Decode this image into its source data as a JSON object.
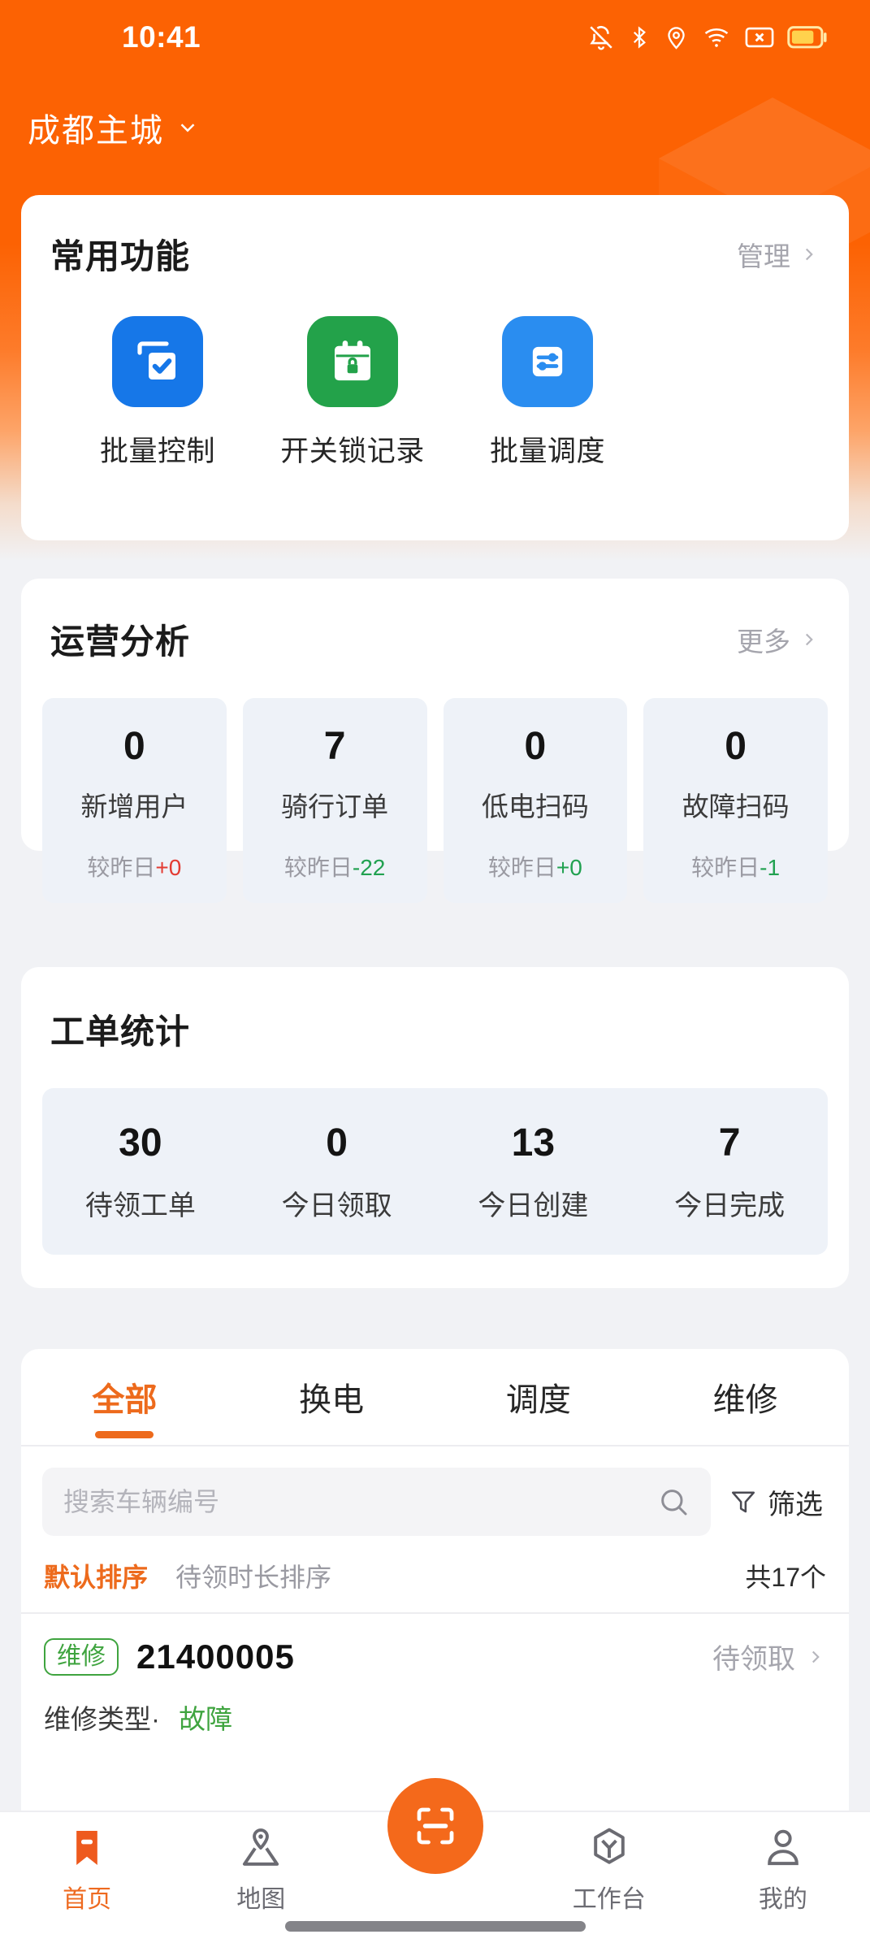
{
  "statusbar": {
    "time": "10:41",
    "icons": [
      "bell-off-icon",
      "bluetooth-icon",
      "location-icon",
      "wifi-icon",
      "sim-x-icon",
      "battery-icon"
    ]
  },
  "header": {
    "city": "成都主城",
    "chevron": "chevron-down-icon",
    "bg_color": "#fc6203"
  },
  "quick": {
    "title": "常用功能",
    "link": "管理",
    "items": [
      {
        "label": "批量控制",
        "icon": "batch-control-icon",
        "color": "#1677e8"
      },
      {
        "label": "开关锁记录",
        "icon": "lock-record-icon",
        "color": "#23a24a"
      },
      {
        "label": "批量调度",
        "icon": "batch-dispatch-icon",
        "color": "#2a8df0"
      }
    ]
  },
  "ops": {
    "title": "运营分析",
    "link": "更多",
    "cells": [
      {
        "value": "0",
        "label": "新增用户",
        "delta_prefix": "较昨日",
        "delta": "+0",
        "delta_color": "#e33b32"
      },
      {
        "value": "7",
        "label": "骑行订单",
        "delta_prefix": "较昨日",
        "delta": "-22",
        "delta_color": "#21a150"
      },
      {
        "value": "0",
        "label": "低电扫码",
        "delta_prefix": "较昨日",
        "delta": "+0",
        "delta_color": "#21a150"
      },
      {
        "value": "0",
        "label": "故障扫码",
        "delta_prefix": "较昨日",
        "delta": "-1",
        "delta_color": "#21a150"
      }
    ]
  },
  "workorder_stats": {
    "title": "工单统计",
    "cells": [
      {
        "value": "30",
        "label": "待领工单"
      },
      {
        "value": "0",
        "label": "今日领取"
      },
      {
        "value": "13",
        "label": "今日创建"
      },
      {
        "value": "7",
        "label": "今日完成"
      }
    ]
  },
  "list": {
    "tabs": [
      {
        "label": "全部",
        "active": true
      },
      {
        "label": "换电",
        "active": false
      },
      {
        "label": "调度",
        "active": false
      },
      {
        "label": "维修",
        "active": false
      }
    ],
    "search": {
      "placeholder": "搜索车辆编号",
      "value": "",
      "icon": "search-icon"
    },
    "filter": {
      "label": "筛选",
      "icon": "funnel-icon"
    },
    "sort": {
      "options": [
        {
          "label": "默认排序",
          "active": true
        },
        {
          "label": "待领时长排序",
          "active": false
        }
      ],
      "total": "共17个"
    },
    "items": [
      {
        "badge": "维修",
        "code": "21400005",
        "status": "待领取",
        "status_chevron": "chevron-right-icon",
        "sub_label": "维修类型·",
        "sub_value": "故障"
      }
    ]
  },
  "bottomnav": {
    "items": [
      {
        "label": "首页",
        "icon": "home-bookmark-icon",
        "active": true
      },
      {
        "label": "地图",
        "icon": "map-pin-icon",
        "active": false
      },
      {
        "label": "工作台",
        "icon": "workbench-icon",
        "active": false
      },
      {
        "label": "我的",
        "icon": "person-icon",
        "active": false
      }
    ],
    "scan": {
      "icon": "scan-icon",
      "color": "#f4691b"
    }
  }
}
